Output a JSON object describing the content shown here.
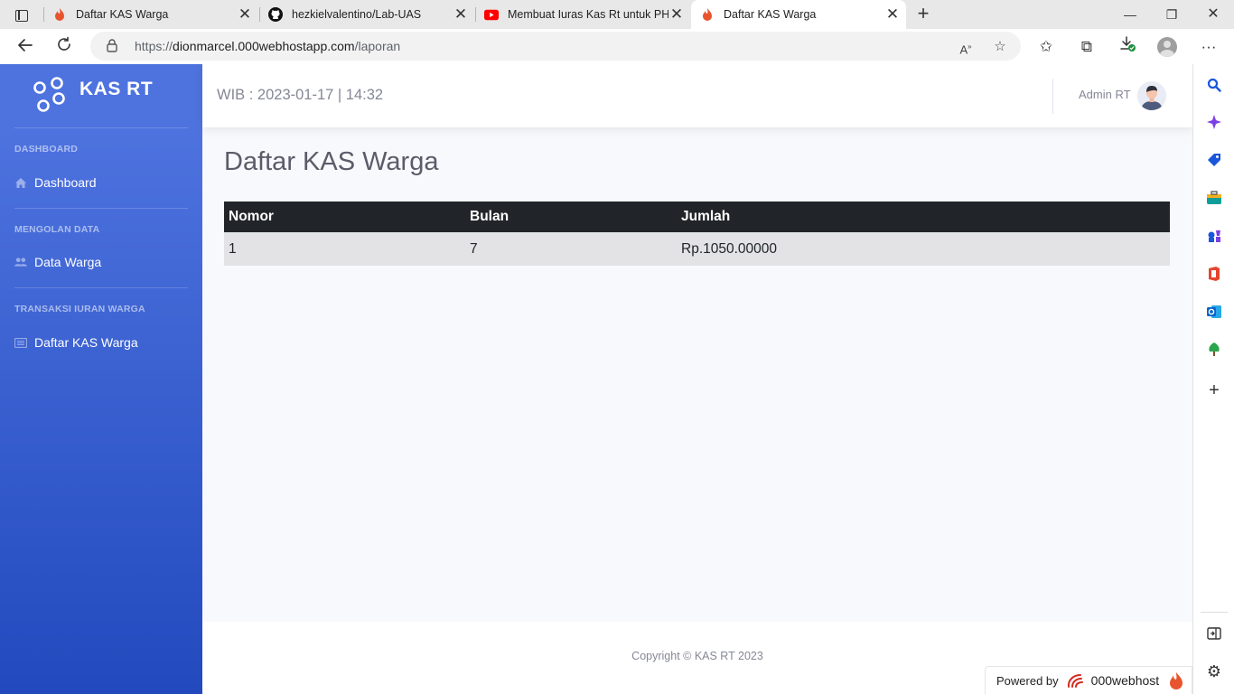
{
  "browser": {
    "tabs": [
      {
        "title": "Daftar KAS Warga",
        "icon": "flame-icon",
        "active": false
      },
      {
        "title": "hezkielvalentino/Lab-UAS",
        "icon": "github-icon",
        "active": false
      },
      {
        "title": "Membuat Iuras Kas Rt untuk PHP",
        "icon": "youtube-icon",
        "active": false
      },
      {
        "title": "Daftar KAS Warga",
        "icon": "flame-icon",
        "active": true
      }
    ],
    "url_prefix": "https://",
    "url_host": "dionmarcel.000webhostapp.com",
    "url_path": "/laporan"
  },
  "app": {
    "brand": "KAS RT",
    "datetime": "WIB : 2023-01-17 | 14:32",
    "user_name": "Admin RT",
    "sidebar": {
      "sections": [
        {
          "heading": "DASHBOARD",
          "items": [
            {
              "label": "Dashboard",
              "icon": "home-icon"
            }
          ]
        },
        {
          "heading": "MENGOLAN DATA",
          "items": [
            {
              "label": "Data Warga",
              "icon": "users-icon"
            }
          ]
        },
        {
          "heading": "TRANSAKSI IURAN WARGA",
          "items": [
            {
              "label": "Daftar KAS Warga",
              "icon": "list-icon"
            }
          ]
        }
      ]
    },
    "page_title": "Daftar KAS Warga",
    "table": {
      "headers": [
        "Nomor",
        "Bulan",
        "Jumlah"
      ],
      "rows": [
        [
          "1",
          "7",
          "Rp.1050.00000"
        ]
      ]
    },
    "footer": "Copyright © KAS RT 2023"
  },
  "host_badge": {
    "label": "Powered by",
    "brand": "000webhost"
  },
  "colors": {
    "sidebar_start": "#4e73df",
    "sidebar_end": "#224abe",
    "table_header": "#212529"
  }
}
